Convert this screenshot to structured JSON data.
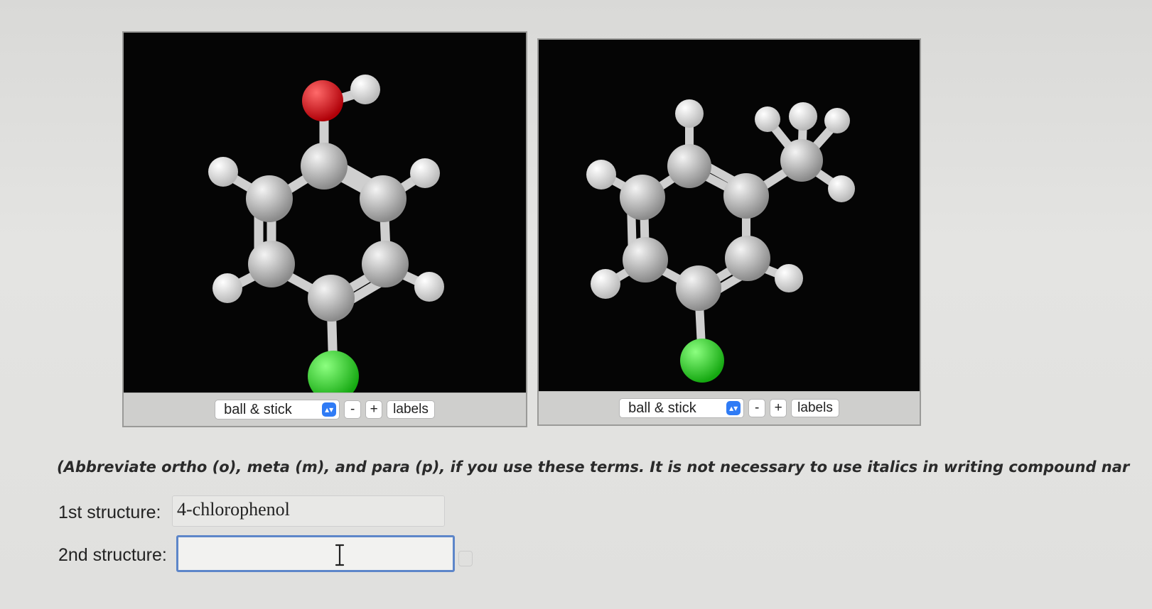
{
  "viewers": [
    {
      "display_mode": "ball & stick",
      "minus_label": "-",
      "plus_label": "+",
      "labels_label": "labels",
      "molecule": "chlorophenol",
      "atom_colors": {
        "carbon": "#c8c8c8",
        "hydrogen": "#f2f2f2",
        "oxygen": "#e0141c",
        "chlorine": "#2ee02a"
      }
    },
    {
      "display_mode": "ball & stick",
      "minus_label": "-",
      "plus_label": "+",
      "labels_label": "labels",
      "molecule": "chlorotoluene",
      "atom_colors": {
        "carbon": "#c8c8c8",
        "hydrogen": "#f2f2f2",
        "chlorine": "#2ee02a"
      }
    }
  ],
  "instructions": "(Abbreviate ortho (o), meta (m), and para (p), if you use these terms. It is not necessary to use italics in writing compound nar",
  "answers": [
    {
      "label": "1st structure:",
      "value": "4-chlorophenol"
    },
    {
      "label": "2nd structure:",
      "value": ""
    }
  ],
  "colors": {
    "accent": "#2f7bf5",
    "focus_border": "#5d86c9"
  }
}
